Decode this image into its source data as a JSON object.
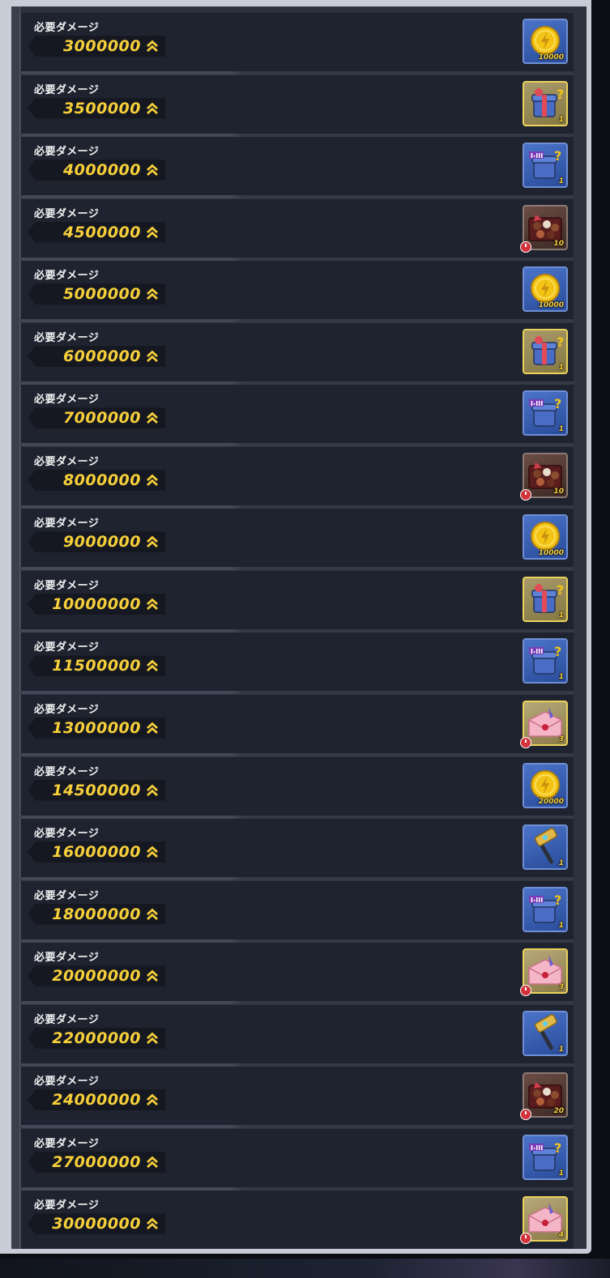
{
  "header": {
    "label": "必要ダメージ"
  },
  "icons": {
    "rank": "double-chevron-up-icon",
    "coin": "gold-coin-icon",
    "gift-box": "mystery-gift-box-icon",
    "tier-box": "tier-mystery-box-icon",
    "chocolate": "chocolate-box-icon",
    "letter": "love-letter-icon",
    "hammer": "hammer-icon",
    "timer": "limited-time-icon"
  },
  "rewards": [
    {
      "label": "必要ダメージ",
      "damage": "3000000",
      "item": "coin",
      "quantity": "10000",
      "timed": false
    },
    {
      "label": "必要ダメージ",
      "damage": "3500000",
      "item": "gift-box",
      "quantity": "1",
      "timed": false
    },
    {
      "label": "必要ダメージ",
      "damage": "4000000",
      "item": "tier-box",
      "quantity": "1",
      "timed": false
    },
    {
      "label": "必要ダメージ",
      "damage": "4500000",
      "item": "chocolate",
      "quantity": "10",
      "timed": true
    },
    {
      "label": "必要ダメージ",
      "damage": "5000000",
      "item": "coin",
      "quantity": "10000",
      "timed": false
    },
    {
      "label": "必要ダメージ",
      "damage": "6000000",
      "item": "gift-box",
      "quantity": "1",
      "timed": false
    },
    {
      "label": "必要ダメージ",
      "damage": "7000000",
      "item": "tier-box",
      "quantity": "1",
      "timed": false
    },
    {
      "label": "必要ダメージ",
      "damage": "8000000",
      "item": "chocolate",
      "quantity": "10",
      "timed": true
    },
    {
      "label": "必要ダメージ",
      "damage": "9000000",
      "item": "coin",
      "quantity": "10000",
      "timed": false
    },
    {
      "label": "必要ダメージ",
      "damage": "10000000",
      "item": "gift-box",
      "quantity": "1",
      "timed": false
    },
    {
      "label": "必要ダメージ",
      "damage": "11500000",
      "item": "tier-box",
      "quantity": "1",
      "timed": false
    },
    {
      "label": "必要ダメージ",
      "damage": "13000000",
      "item": "letter",
      "quantity": "3",
      "timed": true
    },
    {
      "label": "必要ダメージ",
      "damage": "14500000",
      "item": "coin",
      "quantity": "20000",
      "timed": false
    },
    {
      "label": "必要ダメージ",
      "damage": "16000000",
      "item": "hammer",
      "quantity": "1",
      "timed": false
    },
    {
      "label": "必要ダメージ",
      "damage": "18000000",
      "item": "tier-box",
      "quantity": "1",
      "timed": false
    },
    {
      "label": "必要ダメージ",
      "damage": "20000000",
      "item": "letter",
      "quantity": "3",
      "timed": true
    },
    {
      "label": "必要ダメージ",
      "damage": "22000000",
      "item": "hammer",
      "quantity": "1",
      "timed": false
    },
    {
      "label": "必要ダメージ",
      "damage": "24000000",
      "item": "chocolate",
      "quantity": "20",
      "timed": true
    },
    {
      "label": "必要ダメージ",
      "damage": "27000000",
      "item": "tier-box",
      "quantity": "1",
      "timed": false
    },
    {
      "label": "必要ダメージ",
      "damage": "30000000",
      "item": "letter",
      "quantity": "4",
      "timed": true
    }
  ],
  "scroll": {
    "position_fraction": 0.0,
    "visible_fraction": 0.07
  },
  "colors": {
    "accent": "#f6cf3a",
    "row": "#1f2330",
    "timer": "#d3323a"
  }
}
